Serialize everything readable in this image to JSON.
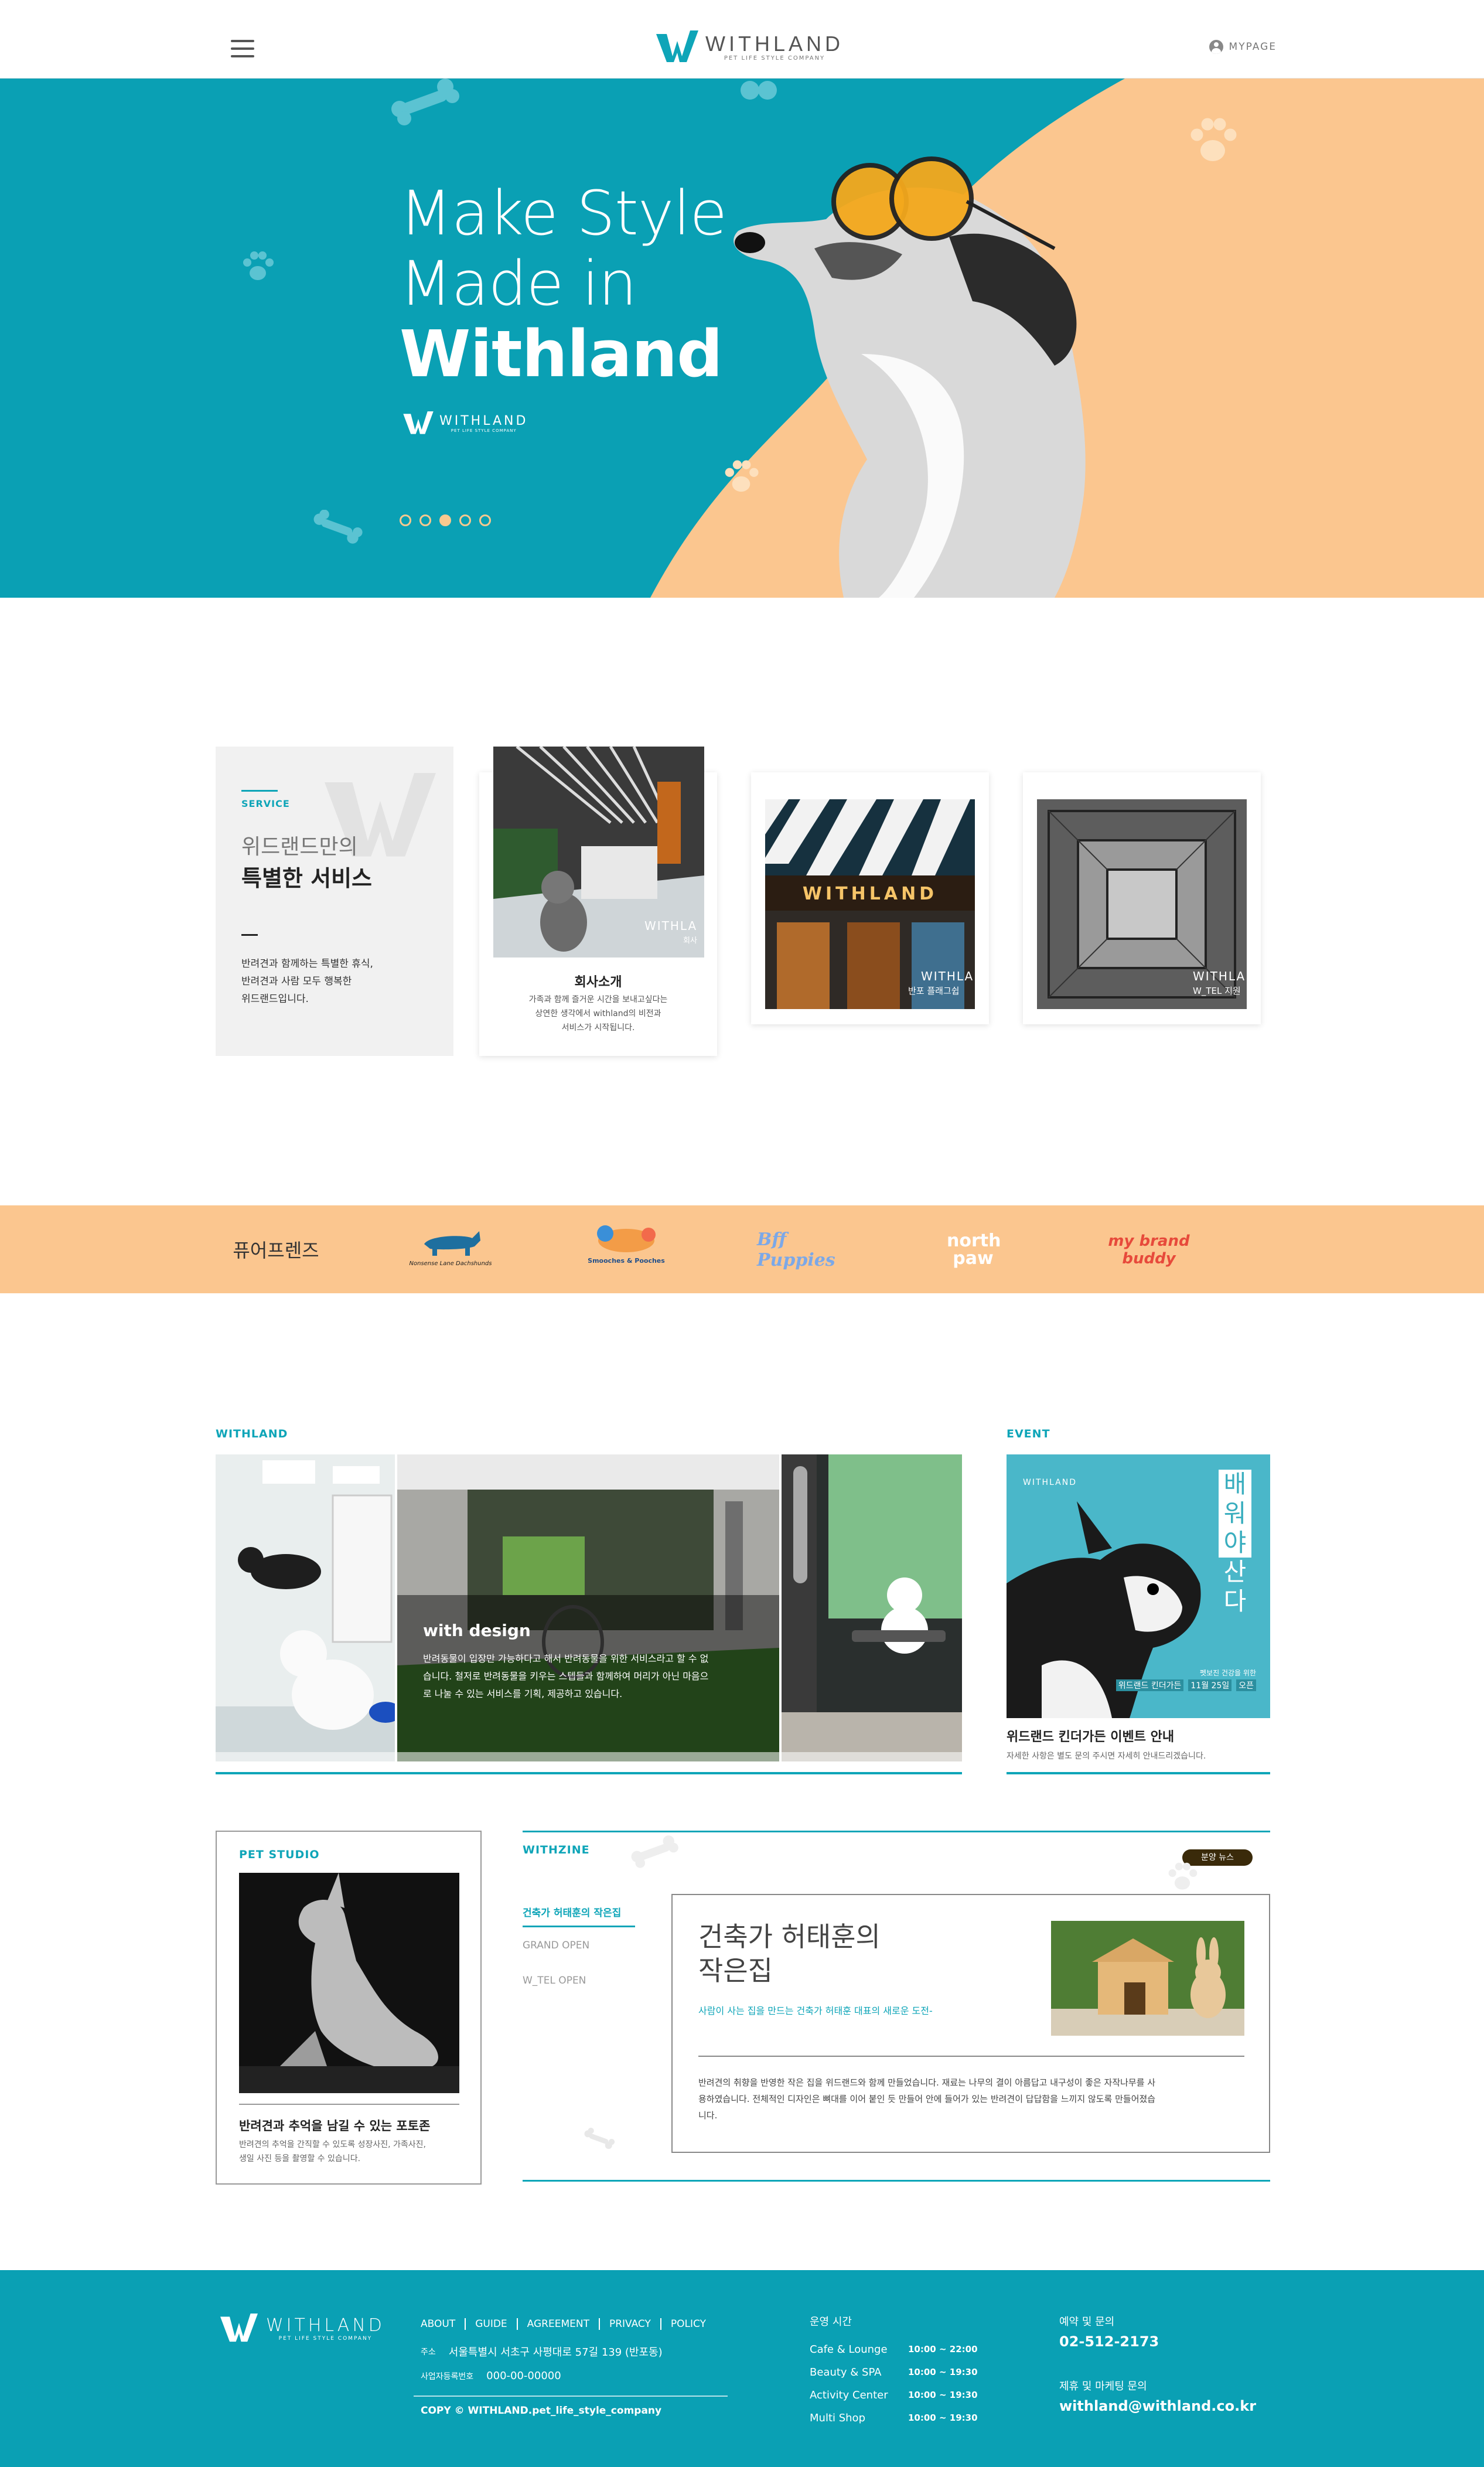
{
  "header": {
    "brand": "WITHLAND",
    "tagline": "PET LIFE STYLE COMPANY",
    "mypage": "MYPAGE"
  },
  "hero": {
    "line1": "Make Style",
    "line2": "Made in",
    "line3": "Withland",
    "logo_text": "WITHLAND",
    "logo_tagline": "PET LIFE STYLE COMPANY",
    "slides": 5,
    "active_slide": 3
  },
  "service": {
    "label": "SERVICE",
    "title_light": "위드랜드만의",
    "title_bold": "특별한 서비스",
    "desc": [
      "반려견과 함께하는 특별한 휴식,",
      "반려견과 사람 모두 행복한",
      "위드랜드입니다."
    ],
    "cards": [
      {
        "overlay": "WITHLA",
        "overlay_sub": "회사",
        "title": "회사소개",
        "desc": [
          "가족과 함께 즐거운 시간을 보내고싶다는",
          "상연한 생각에서 withland의 비전과",
          "서비스가 시작됩니다."
        ]
      },
      {
        "sign": "WITHLAND",
        "overlay": "WITHLA",
        "overlay_sub": "반포 플래그쉽"
      },
      {
        "overlay": "WITHLA",
        "overlay_sub": "W_TEL 지원"
      }
    ]
  },
  "brands": [
    "퓨어프렌즈",
    "Nonsense Lane Dachshunds",
    "Smooches & Pooches",
    "Bff Puppies",
    "north paw",
    "my brand buddy"
  ],
  "withland": {
    "label": "WITHLAND",
    "overlay_title": "with design",
    "overlay_desc": [
      "반려동물이 입장만 가능하다고 해서 반려동물을 위한 서비스라고 할 수 없",
      "습니다. 철저로 반려동물을 키우는 스텝들과 함께하여 머리가 아닌 마음으",
      "로 나눌 수 있는 서비스를 기획, 제공하고 있습니다."
    ]
  },
  "event": {
    "label": "EVENT",
    "poster_logo": "WITHLAND",
    "poster_vertical": [
      "배",
      "워",
      "야",
      "산",
      "다"
    ],
    "poster_small": "펫보진 건강을 위한",
    "poster_date_label": "위드랜드 킨더가든",
    "poster_date": "11월 25일",
    "poster_open": "오픈",
    "title": "위드랜드 킨더가든 이벤트 안내",
    "desc": "자세한 사항은 별도 문의 주시면 자세히 안내드리겠습니다."
  },
  "pet_studio": {
    "label": "PET STUDIO",
    "title": "반려견과 추억을 남길 수 있는 포토존",
    "desc": [
      "반려견의 추억을 간직할 수 있도록 성장사진, 가족사진,",
      "생일 사진 등을 촬영할 수 있습니다."
    ]
  },
  "withzine": {
    "label": "WITHZINE",
    "badge": "분양 뉴스",
    "tabs": [
      "건축가 허태훈의 작은집",
      "GRAND OPEN",
      "W_TEL OPEN"
    ],
    "active_tab": 0,
    "article_title": [
      "건축가 허태훈의",
      "작은집"
    ],
    "article_sub": "사람이 사는 집을 만드는 건축가 허태훈 대표의 새로운 도전-",
    "article_body": [
      "반려견의 취향을 반영한 작은 집을 위드랜드와 함께 만들었습니다. 재료는 나무의 결이 아름답고 내구성이 좋은 자작나무를 사",
      "용하였습니다. 전체적인 디자인은 뼈대를 이어 붙인 듯 만들어 안에 들어가 있는 반려견이 답답함을 느끼지 않도록 만들어졌습",
      "니다."
    ]
  },
  "footer": {
    "brand": "WITHLAND",
    "tagline": "PET LIFE STYLE COMPANY",
    "nav": [
      "ABOUT",
      "GUIDE",
      "AGREEMENT",
      "PRIVACY",
      "POLICY"
    ],
    "address_label": "주소",
    "address": "서울특별시 서초구 사평대로 57길 139 (반포동)",
    "bizno_label": "사업자등록번호",
    "bizno": "000-00-00000",
    "copyright": "COPY © WITHLAND.pet_life_style_company",
    "hours_title": "운영 시간",
    "hours": [
      {
        "name": "Cafe & Lounge",
        "time": "10:00 ~ 22:00"
      },
      {
        "name": "Beauty & SPA",
        "time": "10:00 ~ 19:30"
      },
      {
        "name": "Activity Center",
        "time": "10:00 ~ 19:30"
      },
      {
        "name": "Multi Shop",
        "time": "10:00 ~ 19:30"
      }
    ],
    "reserve_title": "예약 및 문의",
    "reserve_phone": "02-512-2173",
    "marketing_title": "제휴 및 마케팅 문의",
    "marketing_email": "withland@withland.co.kr"
  },
  "colors": {
    "teal": "#0aa0b4",
    "peach": "#fbc68f",
    "text": "#222222"
  }
}
